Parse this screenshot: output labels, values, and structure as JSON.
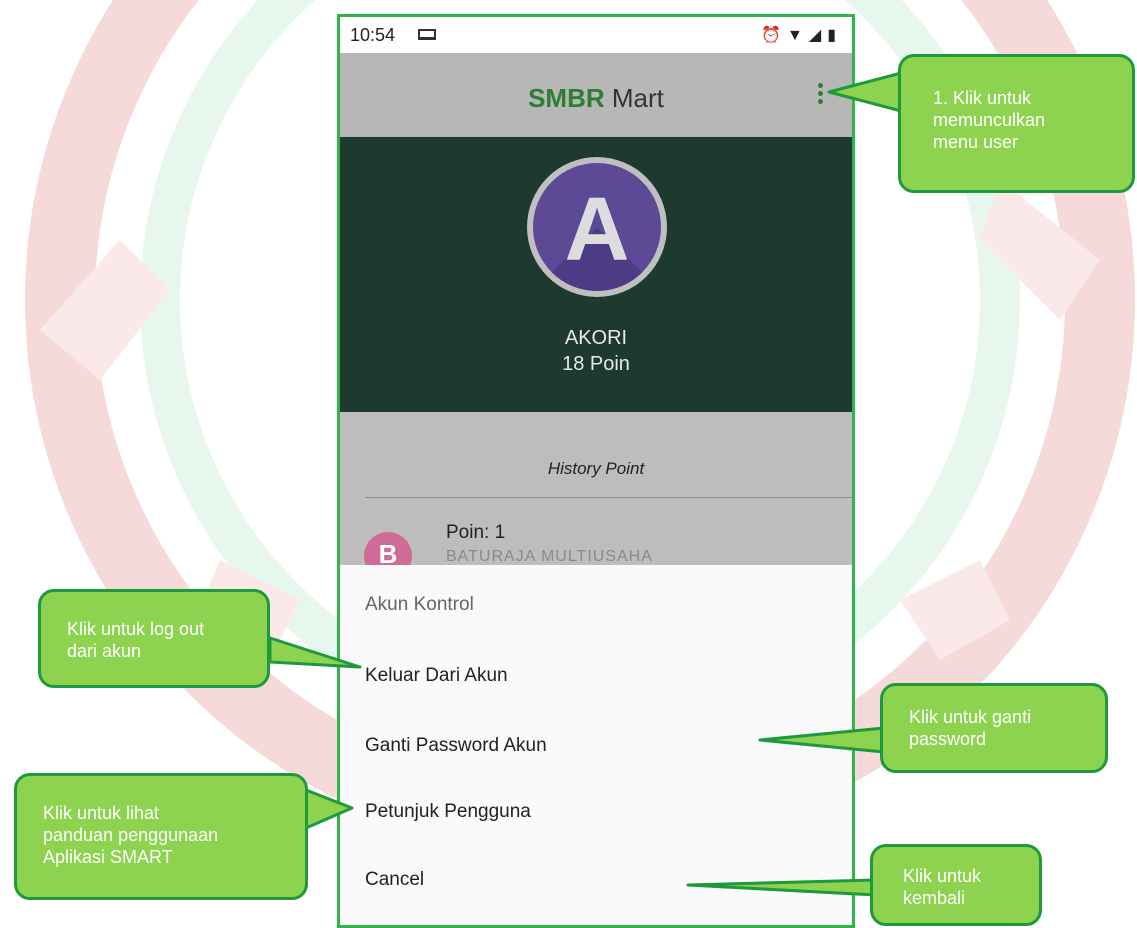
{
  "status_bar": {
    "time": "10:54",
    "icons": [
      "laptop-icon",
      "alarm-icon",
      "wifi-icon",
      "signal-icon",
      "battery-icon"
    ]
  },
  "app_bar": {
    "title_brand": "SMBR",
    "title_rest": " Mart",
    "brand_color": "#2e7d32"
  },
  "profile": {
    "avatar_letter": "A",
    "name": "AKORI",
    "points": "18 Poin"
  },
  "history": {
    "title": "History Point",
    "items": [
      {
        "avatar_letter": "B",
        "title": "Poin: 1",
        "subtitle": "BATURAJA MULTIUSAHA"
      }
    ]
  },
  "sheet": {
    "title": "Akun Kontrol",
    "options": [
      "Keluar Dari Akun",
      "Ganti Password Akun",
      "Petunjuk Pengguna",
      "Cancel"
    ]
  },
  "callouts": {
    "menu": [
      "1. Klik untuk",
      "memunculkan",
      "menu user"
    ],
    "logout": [
      "Klik untuk log out",
      "dari akun"
    ],
    "password": [
      "Klik untuk ganti",
      "password"
    ],
    "guide": [
      "Klik untuk lihat",
      "panduan penggunaan",
      "Aplikasi SMART"
    ],
    "back": [
      "Klik untuk",
      "kembali"
    ]
  },
  "colors": {
    "callout_fill": "#8dd34f",
    "callout_border": "#1e9a3c",
    "frame": "#2fb54a",
    "profile_bg": "#1e3a2f"
  }
}
